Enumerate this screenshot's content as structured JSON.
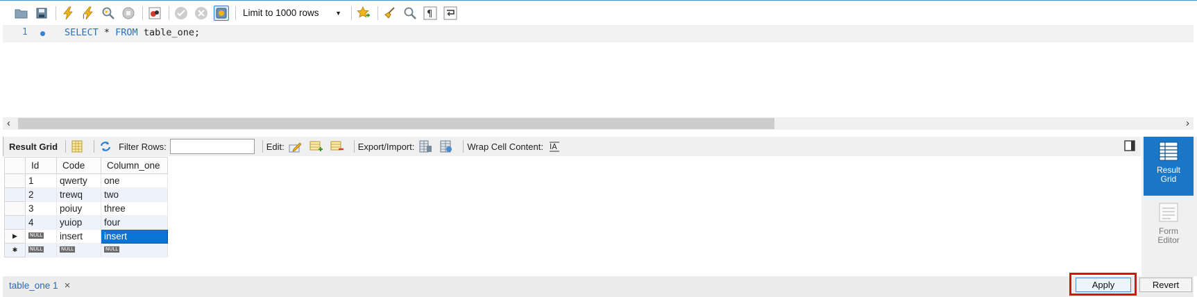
{
  "toolbar": {
    "limit_select": "Limit to 1000 rows"
  },
  "editor": {
    "line_number": "1",
    "sql_keyword1": "SELECT",
    "sql_text1": " * ",
    "sql_keyword2": "FROM",
    "sql_text2": " table_one;"
  },
  "results": {
    "tab_label": "Result Grid",
    "filter_label": "Filter Rows:",
    "filter_value": "",
    "edit_label": "Edit:",
    "export_label": "Export/Import:",
    "wrap_label": "Wrap Cell Content:",
    "columns": [
      "Id",
      "Code",
      "Column_one"
    ],
    "rows": [
      [
        "1",
        "qwerty",
        "one"
      ],
      [
        "2",
        "trewq",
        "two"
      ],
      [
        "3",
        "poiuy",
        "three"
      ],
      [
        "4",
        "yuiop",
        "four"
      ]
    ],
    "edit_row": [
      "NULL",
      "insert",
      "insert"
    ],
    "new_row": [
      "NULL",
      "NULL",
      "NULL"
    ]
  },
  "side_panel": {
    "result_grid_label_1": "Result",
    "result_grid_label_2": "Grid",
    "form_editor_label_1": "Form",
    "form_editor_label_2": "Editor"
  },
  "bottom": {
    "tab_name": "table_one 1",
    "close_glyph": "×",
    "apply_label": "Apply",
    "revert_label": "Revert"
  },
  "colors": {
    "keyword": "#2872c4",
    "selection": "#0a74d6",
    "highlight": "#e01010",
    "side_active": "#1b78c9"
  }
}
